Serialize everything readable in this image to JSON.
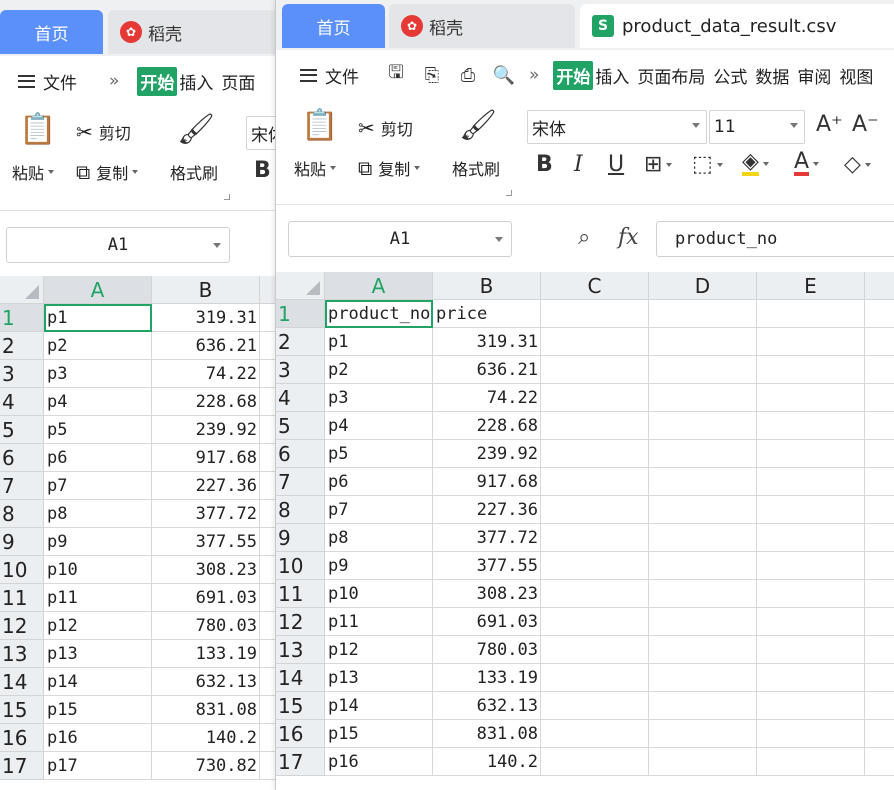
{
  "back_window": {
    "tabs": {
      "home": "首页",
      "daoke": "稻壳"
    },
    "menu": {
      "file": "文件",
      "more": "»",
      "start": "开始",
      "insert": "插入",
      "layout": "页面"
    },
    "ribbon": {
      "paste": "粘贴",
      "cut": "剪切",
      "copy": "复制",
      "format_painter": "格式刷",
      "font_name": "宋体",
      "bold": "B"
    },
    "name_box": "A1",
    "columns": [
      "A",
      "B"
    ],
    "rows": [
      {
        "n": "1",
        "a": "p1",
        "b": "319.31"
      },
      {
        "n": "2",
        "a": "p2",
        "b": "636.21"
      },
      {
        "n": "3",
        "a": "p3",
        "b": "74.22"
      },
      {
        "n": "4",
        "a": "p4",
        "b": "228.68"
      },
      {
        "n": "5",
        "a": "p5",
        "b": "239.92"
      },
      {
        "n": "6",
        "a": "p6",
        "b": "917.68"
      },
      {
        "n": "7",
        "a": "p7",
        "b": "227.36"
      },
      {
        "n": "8",
        "a": "p8",
        "b": "377.72"
      },
      {
        "n": "9",
        "a": "p9",
        "b": "377.55"
      },
      {
        "n": "10",
        "a": "p10",
        "b": "308.23"
      },
      {
        "n": "11",
        "a": "p11",
        "b": "691.03"
      },
      {
        "n": "12",
        "a": "p12",
        "b": "780.03"
      },
      {
        "n": "13",
        "a": "p13",
        "b": "133.19"
      },
      {
        "n": "14",
        "a": "p14",
        "b": "632.13"
      },
      {
        "n": "15",
        "a": "p15",
        "b": "831.08"
      },
      {
        "n": "16",
        "a": "p16",
        "b": "140.2"
      },
      {
        "n": "17",
        "a": "p17",
        "b": "730.82"
      }
    ]
  },
  "front_window": {
    "tabs": {
      "home": "首页",
      "daoke": "稻壳",
      "file": "product_data_result.csv",
      "file_icon": "S"
    },
    "menu": {
      "file": "文件",
      "more": "»",
      "start": "开始",
      "insert": "插入",
      "page_layout": "页面布局",
      "formula": "公式",
      "data": "数据",
      "review": "审阅",
      "view": "视图"
    },
    "ribbon": {
      "paste": "粘贴",
      "cut": "剪切",
      "copy": "复制",
      "format_painter": "格式刷",
      "font_name": "宋体",
      "font_size": "11",
      "grow_font": "A⁺",
      "shrink_font": "A⁻",
      "bold": "B",
      "italic": "I",
      "underline": "U",
      "font_color_letter": "A"
    },
    "name_box": "A1",
    "formula_label": "fx",
    "formula_value": "product_no",
    "columns": [
      "A",
      "B",
      "C",
      "D",
      "E"
    ],
    "rows": [
      {
        "n": "1",
        "a": "product_no",
        "b": "price"
      },
      {
        "n": "2",
        "a": "p1",
        "b": "319.31"
      },
      {
        "n": "3",
        "a": "p2",
        "b": "636.21"
      },
      {
        "n": "4",
        "a": "p3",
        "b": "74.22"
      },
      {
        "n": "5",
        "a": "p4",
        "b": "228.68"
      },
      {
        "n": "6",
        "a": "p5",
        "b": "239.92"
      },
      {
        "n": "7",
        "a": "p6",
        "b": "917.68"
      },
      {
        "n": "8",
        "a": "p7",
        "b": "227.36"
      },
      {
        "n": "9",
        "a": "p8",
        "b": "377.72"
      },
      {
        "n": "10",
        "a": "p9",
        "b": "377.55"
      },
      {
        "n": "11",
        "a": "p10",
        "b": "308.23"
      },
      {
        "n": "12",
        "a": "p11",
        "b": "691.03"
      },
      {
        "n": "13",
        "a": "p12",
        "b": "780.03"
      },
      {
        "n": "14",
        "a": "p13",
        "b": "133.19"
      },
      {
        "n": "15",
        "a": "p14",
        "b": "632.13"
      },
      {
        "n": "16",
        "a": "p15",
        "b": "831.08"
      },
      {
        "n": "17",
        "a": "p16",
        "b": "140.2"
      }
    ]
  },
  "colors": {
    "accent_green": "#21a366",
    "home_tab_blue": "#5b8ff9",
    "header_gray": "#eceff2"
  }
}
